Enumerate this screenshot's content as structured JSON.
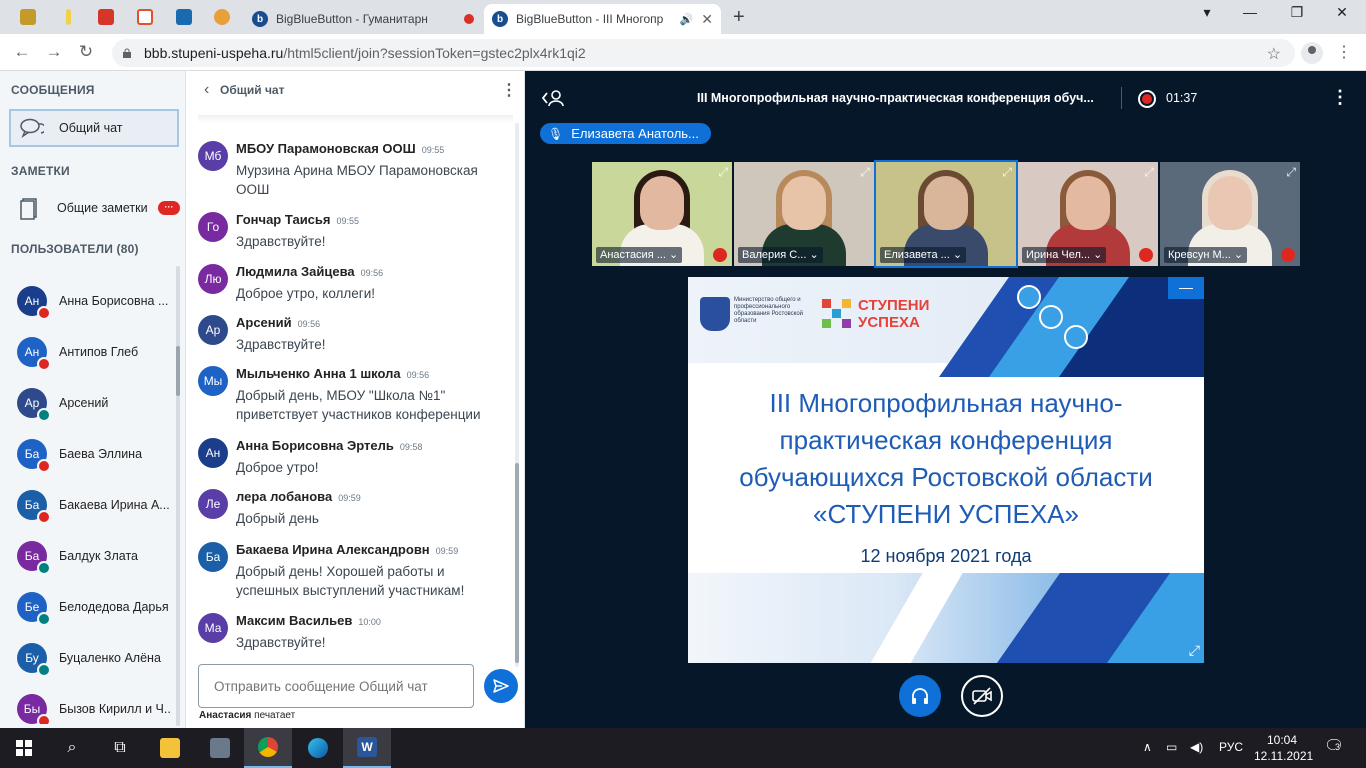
{
  "browser": {
    "tabs": [
      {
        "title": "BigBlueButton - Гуманитарн",
        "recording": true
      },
      {
        "title": "BigBlueButton - III Многопр",
        "audio": true
      }
    ],
    "url_host": "bbb.stupeni-uspeha.ru",
    "url_path": "/html5client/join?sessionToken=gstec2plx4rk1qi2"
  },
  "sidebar": {
    "messages_title": "СООБЩЕНИЯ",
    "public_chat_label": "Общий чат",
    "notes_title": "ЗАМЕТКИ",
    "shared_notes_label": "Общие заметки",
    "notes_badge": "···",
    "users_title": "ПОЛЬЗОВАТЕЛИ (80)",
    "users": [
      {
        "initials": "Ан",
        "name": "Анна Борисовна ...",
        "color": "#1a3e8c",
        "status": "muted"
      },
      {
        "initials": "Ан",
        "name": "Антипов Глеб",
        "color": "#1d62c4",
        "status": "muted"
      },
      {
        "initials": "Ар",
        "name": "Арсений",
        "color": "#2f4a8c",
        "status": "listen"
      },
      {
        "initials": "Ба",
        "name": "Баева Эллина",
        "color": "#1d62c4",
        "status": "muted"
      },
      {
        "initials": "Ба",
        "name": "Бакаева Ирина А...",
        "color": "#1a5fa8",
        "status": "muted"
      },
      {
        "initials": "Ба",
        "name": "Балдук Злата",
        "color": "#7a2aa0",
        "status": "listen"
      },
      {
        "initials": "Бе",
        "name": "Белодедова Дарья",
        "color": "#1d62c4",
        "status": "listen"
      },
      {
        "initials": "Бу",
        "name": "Буцаленко Алёна",
        "color": "#1a5fa8",
        "status": "listen"
      },
      {
        "initials": "Бы",
        "name": "Бызов Кирилл и Ч...",
        "color": "#7a2aa0",
        "status": "muted"
      }
    ]
  },
  "chat": {
    "title": "Общий чат",
    "messages": [
      {
        "initials": "Мб",
        "color": "#5a3ea8",
        "name": "МБОУ Парамоновская ООШ",
        "time": "09:55",
        "text": "Мурзина Арина МБОУ Парамоновская ООШ"
      },
      {
        "initials": "Го",
        "color": "#7a2aa0",
        "name": "Гончар Таисья",
        "time": "09:55",
        "text": "Здравствуйте!"
      },
      {
        "initials": "Лю",
        "color": "#7a2aa0",
        "name": "Людмила Зайцева",
        "time": "09:56",
        "text": "Доброе утро, коллеги!"
      },
      {
        "initials": "Ар",
        "color": "#2f4a8c",
        "name": "Арсений",
        "time": "09:56",
        "text": "Здравствуйте!"
      },
      {
        "initials": "Мы",
        "color": "#1d62c4",
        "name": "Мыльченко Анна 1 школа",
        "time": "09:56",
        "text": "Добрый день, МБОУ \"Школа №1\" приветствует участников конференции"
      },
      {
        "initials": "Ан",
        "color": "#1a3e8c",
        "name": "Анна Борисовна Эртель",
        "time": "09:58",
        "text": "Доброе утро!"
      },
      {
        "initials": "Ле",
        "color": "#5a3ea8",
        "name": "лера лобанова",
        "time": "09:59",
        "text": "Добрый день"
      },
      {
        "initials": "Ба",
        "color": "#1a5fa8",
        "name": "Бакаева Ирина Александровн",
        "time": "09:59",
        "text": "Добрый день! Хорошей работы и успешных выступлений участникам!"
      },
      {
        "initials": "Ма",
        "color": "#5a3ea8",
        "name": "Максим Васильев",
        "time": "10:00",
        "text": "Здравствуйте!"
      }
    ],
    "input_placeholder": "Отправить сообщение Общий чат",
    "typing_user": "Анастасия",
    "typing_suffix": "печатает"
  },
  "meeting": {
    "title": "III Многопрофильная научно-практическая конференция обуч...",
    "timer": "01:37",
    "talker": "Елизавета Анатоль...",
    "videos": [
      {
        "name": "Анастасия ...",
        "bg": "#c9d89a",
        "skin": "#e2b9a0",
        "hair": "#2b1a12",
        "top": "#f4f0ea"
      },
      {
        "name": "Валерия С...",
        "bg": "#cfc6bc",
        "skin": "#e7c3a8",
        "hair": "#b8895a",
        "top": "#1f3a2e"
      },
      {
        "name": "Елизавета ...",
        "bg": "#c7c28a",
        "skin": "#d9b59a",
        "hair": "#6b4a34",
        "top": "#3a4a6a"
      },
      {
        "name": "Ирина Чел...",
        "bg": "#d8c9c2",
        "skin": "#e4b9a2",
        "hair": "#8a5a3a",
        "top": "#b23a3a"
      },
      {
        "name": "Кревсун М...",
        "bg": "#5a6a7a",
        "skin": "#eac7b2",
        "hair": "#e8dccf",
        "top": "#f2efe9"
      }
    ],
    "slide": {
      "ministry": "Министерство общего и профессионального образования Ростовской области",
      "brand_line1": "СТУПЕНИ",
      "brand_line2": "УСПЕХА",
      "line1": "III Многопрофильная научно-",
      "line2": "практическая конференция",
      "line3": "обучающихся Ростовской области",
      "line4": "«СТУПЕНИ УСПЕХА»",
      "date": "12 ноября 2021 года"
    }
  },
  "taskbar": {
    "lang": "РУС",
    "time": "10:04",
    "date": "12.11.2021",
    "notifications": "3"
  }
}
